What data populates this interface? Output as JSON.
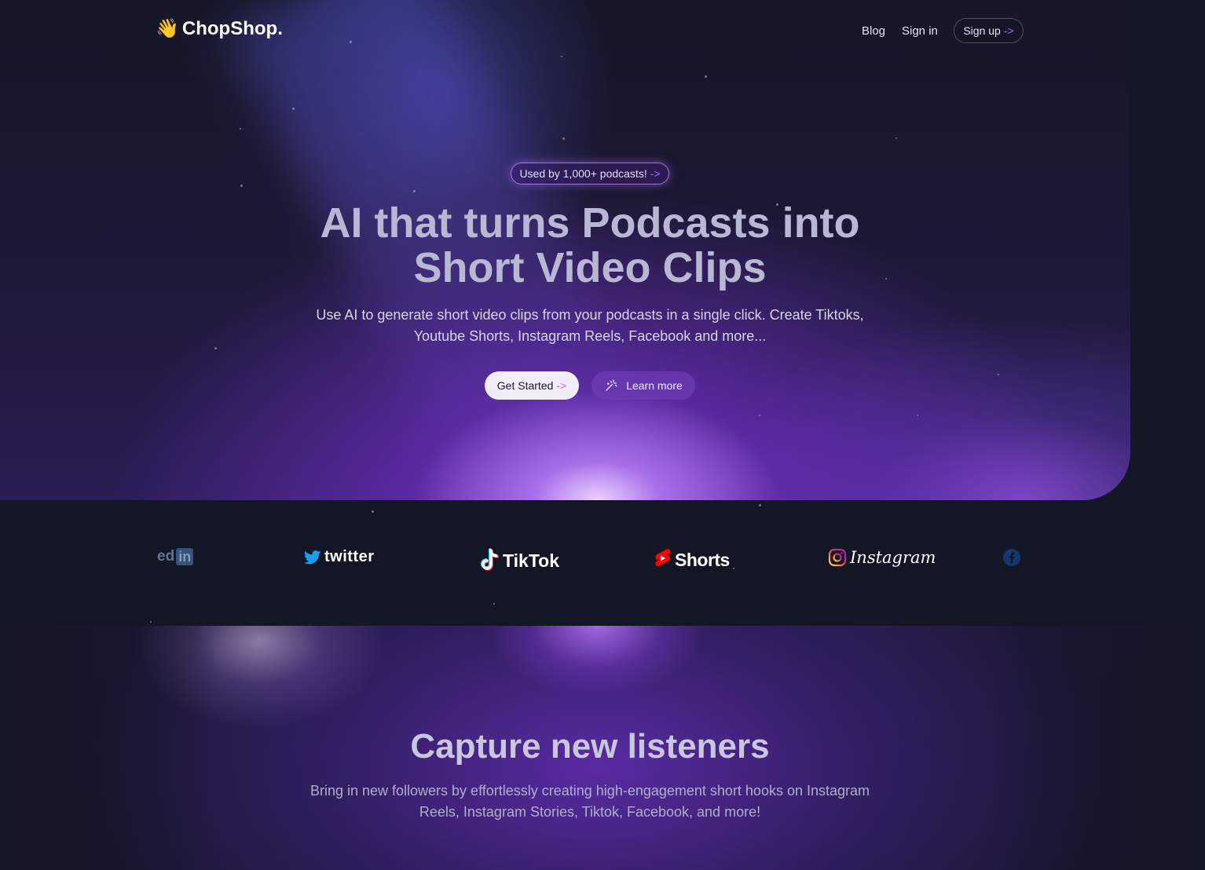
{
  "nav": {
    "logo_text": "ChopShop.",
    "logo_icon": "waving-hand-icon",
    "links": [
      {
        "label": "Blog"
      },
      {
        "label": "Sign in"
      }
    ],
    "signup_label": "Sign up",
    "arrow": "->"
  },
  "hero": {
    "badge_text": "Used by 1,000+ podcasts!",
    "badge_arrow": "->",
    "title_line1": "AI that turns Podcasts into",
    "title_line2": "Short Video Clips",
    "subtitle": "Use AI to generate short video clips from your podcasts in a single click. Create Tiktoks, Youtube Shorts, Instagram Reels, Facebook and more...",
    "primary_button": "Get Started",
    "primary_arrow": "->",
    "secondary_button": "Learn more",
    "secondary_icon": "magic-wand-icon"
  },
  "brands": {
    "linkedin": {
      "text": "ed",
      "badge": "in"
    },
    "twitter": "twitter",
    "tiktok": "TikTok",
    "shorts": "Shorts",
    "instagram": "Instagram"
  },
  "capture": {
    "title": "Capture new listeners",
    "subtitle": "Bring in new followers by effortlessly creating high-engagement short hooks on Instagram Reels, Instagram Stories, Tiktok, Facebook, and more!"
  },
  "colors": {
    "background": "#131624",
    "accent": "#a56bff",
    "hero_glow": "#9a4cf0"
  }
}
